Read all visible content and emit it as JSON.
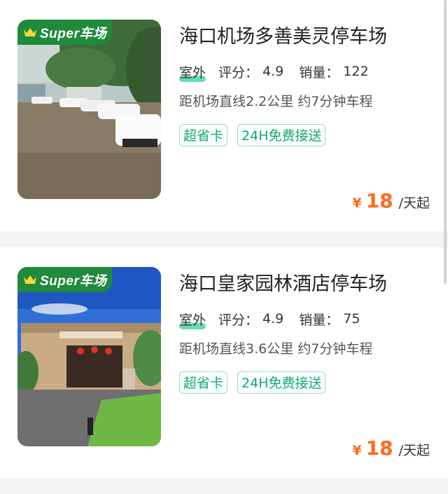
{
  "badge_label": "Super车场",
  "colors": {
    "price": "#ff6b1a",
    "tag": "#17a871",
    "badge": "#1f8a3b",
    "outdoor_highlight": "#4fd6a5"
  },
  "listings": [
    {
      "title": "海口机场多善美灵停车场",
      "type": "室外",
      "score_label": "评分：",
      "score": "4.9",
      "sales_label": "销量：",
      "sales": "122",
      "distance": "距机场直线2.2公里 约7分钟车程",
      "tags": [
        "超省卡",
        "24H免费接送"
      ],
      "currency": "¥",
      "price": "18",
      "unit": "/天起"
    },
    {
      "title": "海口皇家园林酒店停车场",
      "type": "室外",
      "score_label": "评分：",
      "score": "4.9",
      "sales_label": "销量：",
      "sales": "75",
      "distance": "距机场直线3.6公里 约7分钟车程",
      "tags": [
        "超省卡",
        "24H免费接送"
      ],
      "currency": "¥",
      "price": "18",
      "unit": "/天起"
    }
  ]
}
